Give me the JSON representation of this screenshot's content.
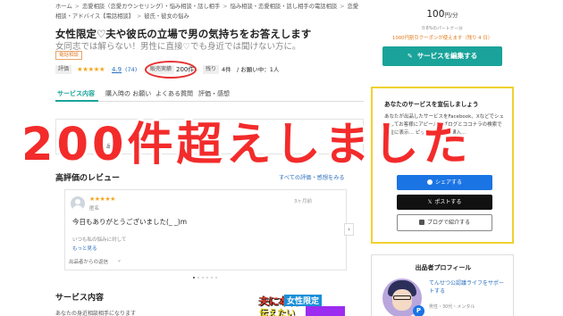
{
  "breadcrumb": {
    "items": [
      "ホーム",
      "恋愛相談（恋愛カウンセリング）・悩み相談・話し相手",
      "悩み相談・恋愛相談・話し相手の電話相談",
      "恋愛相談・アドバイス【電話相談】",
      "彼氏・彼女の悩み"
    ],
    "separator": ">"
  },
  "service": {
    "title": "女性限定♡夫や彼氏の立場で男の気持ちをお答えします",
    "subtitle": "女同志では解らない！男性に直接♡でも身近では聞けない方に。",
    "badge": "電話相談"
  },
  "meta": {
    "rating_tag": "評価",
    "stars": "★★★★★",
    "rating": "4.9",
    "review_count": "(74)",
    "sales_tag": "販売実績",
    "sales": "200件",
    "remaining_tag": "残り",
    "remaining": "4件",
    "pending": "/ お願い中：1人"
  },
  "tabs": [
    {
      "label": "サービス内容",
      "active": true
    },
    {
      "label": "購入時の お願い"
    },
    {
      "label": "よくある質問"
    },
    {
      "label": "評価・感想"
    }
  ],
  "obscured": {
    "frag_a": "別",
    "frag_b": "出品"
  },
  "reviews": {
    "heading": "高評価のレビュー",
    "see_all": "すべての評価・感想をみる",
    "card": {
      "stars": "★★★★★",
      "name": "匿名",
      "date": "3ヶ月前",
      "text": "今日もありがとうございました(_ _)m",
      "sub": "いつも私の悩みに対して",
      "more": "もっと見る",
      "type": "出品者からの返信",
      "type_chevron": "⌄"
    },
    "next_arrow": "›"
  },
  "service_section": {
    "heading": "サービス内容",
    "text": "あなたの身近相談相手になります"
  },
  "thumbnail": {
    "line1": "夫に本音",
    "tag": "女性限定",
    "line2": "伝えたい"
  },
  "sidebar": {
    "price": "100",
    "price_unit": "円/分",
    "fee_note": "0.8%のパートナー分",
    "coupon": "1000円割引クーポンが使えます（残り 4 日）",
    "edit_button": "サービスを編集する",
    "edit_icon": "pencil-icon"
  },
  "promo": {
    "heading": "あなたのサービスを宣伝しましょう",
    "body": "あなたが出品したサービスをFacebook、Xなどでシェアしてお客様にアピール…ブログとココナラの検索で上位に表示… ピックアップ… 購入…",
    "facebook": "シェアする",
    "x": "ポストする",
    "x_glyph": "𝕏",
    "blog": "ブログで紹介する"
  },
  "profile": {
    "heading": "出品者プロフィール",
    "blurb": "てんせつ公認議ライフをサポートする",
    "small": "男性・30代・メンタル",
    "badge": "P"
  },
  "overlay": {
    "text": "200件超えしました",
    "color": "#f32b2b"
  },
  "colors": {
    "accent": "#1aa39a",
    "link": "#2a6fbf",
    "promo_border": "#f0d130",
    "coupon": "#e17a1b"
  }
}
